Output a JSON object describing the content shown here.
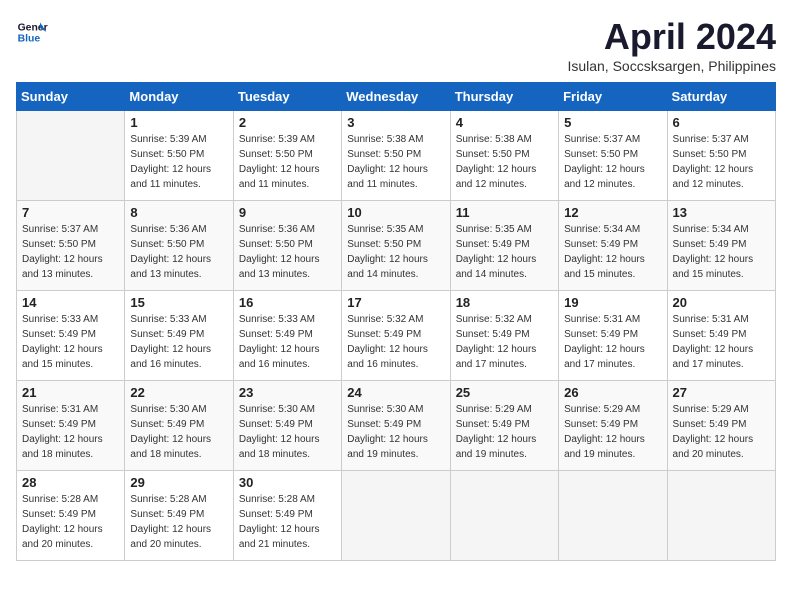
{
  "header": {
    "logo_line1": "General",
    "logo_line2": "Blue",
    "month": "April 2024",
    "location": "Isulan, Soccsksargen, Philippines"
  },
  "weekdays": [
    "Sunday",
    "Monday",
    "Tuesday",
    "Wednesday",
    "Thursday",
    "Friday",
    "Saturday"
  ],
  "weeks": [
    [
      {
        "day": "",
        "info": ""
      },
      {
        "day": "1",
        "info": "Sunrise: 5:39 AM\nSunset: 5:50 PM\nDaylight: 12 hours\nand 11 minutes."
      },
      {
        "day": "2",
        "info": "Sunrise: 5:39 AM\nSunset: 5:50 PM\nDaylight: 12 hours\nand 11 minutes."
      },
      {
        "day": "3",
        "info": "Sunrise: 5:38 AM\nSunset: 5:50 PM\nDaylight: 12 hours\nand 11 minutes."
      },
      {
        "day": "4",
        "info": "Sunrise: 5:38 AM\nSunset: 5:50 PM\nDaylight: 12 hours\nand 12 minutes."
      },
      {
        "day": "5",
        "info": "Sunrise: 5:37 AM\nSunset: 5:50 PM\nDaylight: 12 hours\nand 12 minutes."
      },
      {
        "day": "6",
        "info": "Sunrise: 5:37 AM\nSunset: 5:50 PM\nDaylight: 12 hours\nand 12 minutes."
      }
    ],
    [
      {
        "day": "7",
        "info": "Sunrise: 5:37 AM\nSunset: 5:50 PM\nDaylight: 12 hours\nand 13 minutes."
      },
      {
        "day": "8",
        "info": "Sunrise: 5:36 AM\nSunset: 5:50 PM\nDaylight: 12 hours\nand 13 minutes."
      },
      {
        "day": "9",
        "info": "Sunrise: 5:36 AM\nSunset: 5:50 PM\nDaylight: 12 hours\nand 13 minutes."
      },
      {
        "day": "10",
        "info": "Sunrise: 5:35 AM\nSunset: 5:50 PM\nDaylight: 12 hours\nand 14 minutes."
      },
      {
        "day": "11",
        "info": "Sunrise: 5:35 AM\nSunset: 5:49 PM\nDaylight: 12 hours\nand 14 minutes."
      },
      {
        "day": "12",
        "info": "Sunrise: 5:34 AM\nSunset: 5:49 PM\nDaylight: 12 hours\nand 15 minutes."
      },
      {
        "day": "13",
        "info": "Sunrise: 5:34 AM\nSunset: 5:49 PM\nDaylight: 12 hours\nand 15 minutes."
      }
    ],
    [
      {
        "day": "14",
        "info": "Sunrise: 5:33 AM\nSunset: 5:49 PM\nDaylight: 12 hours\nand 15 minutes."
      },
      {
        "day": "15",
        "info": "Sunrise: 5:33 AM\nSunset: 5:49 PM\nDaylight: 12 hours\nand 16 minutes."
      },
      {
        "day": "16",
        "info": "Sunrise: 5:33 AM\nSunset: 5:49 PM\nDaylight: 12 hours\nand 16 minutes."
      },
      {
        "day": "17",
        "info": "Sunrise: 5:32 AM\nSunset: 5:49 PM\nDaylight: 12 hours\nand 16 minutes."
      },
      {
        "day": "18",
        "info": "Sunrise: 5:32 AM\nSunset: 5:49 PM\nDaylight: 12 hours\nand 17 minutes."
      },
      {
        "day": "19",
        "info": "Sunrise: 5:31 AM\nSunset: 5:49 PM\nDaylight: 12 hours\nand 17 minutes."
      },
      {
        "day": "20",
        "info": "Sunrise: 5:31 AM\nSunset: 5:49 PM\nDaylight: 12 hours\nand 17 minutes."
      }
    ],
    [
      {
        "day": "21",
        "info": "Sunrise: 5:31 AM\nSunset: 5:49 PM\nDaylight: 12 hours\nand 18 minutes."
      },
      {
        "day": "22",
        "info": "Sunrise: 5:30 AM\nSunset: 5:49 PM\nDaylight: 12 hours\nand 18 minutes."
      },
      {
        "day": "23",
        "info": "Sunrise: 5:30 AM\nSunset: 5:49 PM\nDaylight: 12 hours\nand 18 minutes."
      },
      {
        "day": "24",
        "info": "Sunrise: 5:30 AM\nSunset: 5:49 PM\nDaylight: 12 hours\nand 19 minutes."
      },
      {
        "day": "25",
        "info": "Sunrise: 5:29 AM\nSunset: 5:49 PM\nDaylight: 12 hours\nand 19 minutes."
      },
      {
        "day": "26",
        "info": "Sunrise: 5:29 AM\nSunset: 5:49 PM\nDaylight: 12 hours\nand 19 minutes."
      },
      {
        "day": "27",
        "info": "Sunrise: 5:29 AM\nSunset: 5:49 PM\nDaylight: 12 hours\nand 20 minutes."
      }
    ],
    [
      {
        "day": "28",
        "info": "Sunrise: 5:28 AM\nSunset: 5:49 PM\nDaylight: 12 hours\nand 20 minutes."
      },
      {
        "day": "29",
        "info": "Sunrise: 5:28 AM\nSunset: 5:49 PM\nDaylight: 12 hours\nand 20 minutes."
      },
      {
        "day": "30",
        "info": "Sunrise: 5:28 AM\nSunset: 5:49 PM\nDaylight: 12 hours\nand 21 minutes."
      },
      {
        "day": "",
        "info": ""
      },
      {
        "day": "",
        "info": ""
      },
      {
        "day": "",
        "info": ""
      },
      {
        "day": "",
        "info": ""
      }
    ]
  ]
}
